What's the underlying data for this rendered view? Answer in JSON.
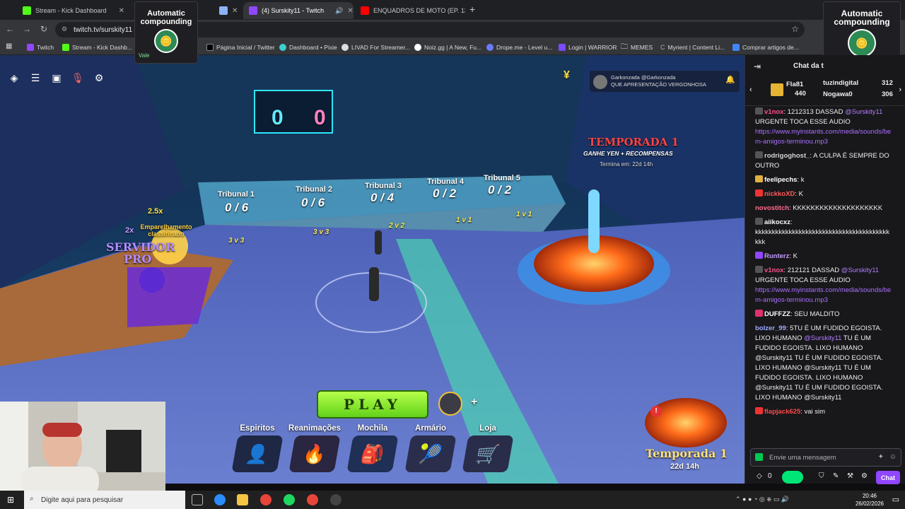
{
  "tabs": [
    {
      "label": "Stream - Kick Dashboard"
    },
    {
      "label": ""
    },
    {
      "label": "(4) Surskity11 - Twitch"
    },
    {
      "label": "ENQUADROS DE MOTO (EP. 13"
    }
  ],
  "address": {
    "url": "twitch.tv/surskity11"
  },
  "bookmarks": [
    "Twitch",
    "Stream - Kick Dashb...",
    "Página Inicial / Twitter",
    "Dashboard • Pixie",
    "LIVAD For Streamer...",
    "Noiz.gg | A New, Fu...",
    "Drope.me - Level u...",
    "Login | WARRIOR",
    "MEMES",
    "Myrient | Content Li...",
    "Comprar artigos de..."
  ],
  "ad": {
    "title": "Automatic compounding",
    "badge": "Vale"
  },
  "game": {
    "score_left": "0",
    "score_right": "0",
    "notification": {
      "name": "Garkonzada @Garkonzada",
      "text": "QUE APRESENTAÇÃO VERGONHOSA"
    },
    "season": {
      "title": "TEMPORADA 1",
      "subtitle": "GANHE YEN + RECOMPENSAS",
      "ends": "Termina em: 22d 14h"
    },
    "tribunals": [
      {
        "name": "Tribunal 1",
        "count": "0 / 6"
      },
      {
        "name": "Tribunal 2",
        "count": "0 / 6"
      },
      {
        "name": "Tribunal 3",
        "count": "0 / 4"
      },
      {
        "name": "Tribunal 4",
        "count": "0 / 2"
      },
      {
        "name": "Tribunal 5",
        "count": "0 / 2"
      }
    ],
    "pads": [
      "3 v 3",
      "3 v 3",
      "2 v 2",
      "1 v 1",
      "1 v 1"
    ],
    "multiplier_a": "2.5x",
    "multiplier_b": "2x",
    "ranked_text": "Emparelhamento classificado",
    "server_line1": "SERVIDOR",
    "server_line2": "PRO",
    "play_label": "PLAY",
    "menu": [
      {
        "label": "Espiritos",
        "icon": "spirit-icon"
      },
      {
        "label": "Reanimações",
        "icon": "flame-icon"
      },
      {
        "label": "Mochila",
        "icon": "bag-icon"
      },
      {
        "label": "Armário",
        "icon": "racket-icon"
      },
      {
        "label": "Loja",
        "icon": "cart-icon"
      }
    ],
    "season_badge": {
      "title": "Temporada 1",
      "time": "22d 14h"
    }
  },
  "chat": {
    "header": "Chat da t",
    "leaderboard": [
      {
        "name": "Fla81",
        "score": "440"
      },
      {
        "name": "tuzindigital",
        "score": "312"
      },
      {
        "name": "Nogawa0",
        "score": "306"
      }
    ],
    "messages": [
      {
        "user": "v1nox",
        "color": "#ff4f8b",
        "text": ": 1212313 DASSAD ",
        "mention": "@Surskity11",
        "rest": " URGENTE TOCA ESSE AUDIO ",
        "link": "https://www.myinstants.com/media/sounds/bem-amigos-terminou.mp3"
      },
      {
        "user": "rodrigoghost_",
        "color": "#d2d2d2",
        "text": ": A CULPA É SEMPRE DO OUTRO",
        "mention": "",
        "rest": "",
        "link": ""
      },
      {
        "user": "feelipechs",
        "color": "#ffffff",
        "text": ": k",
        "mention": "",
        "rest": "",
        "link": ""
      },
      {
        "user": "nickkoXD",
        "color": "#ff5a5a",
        "text": ": K",
        "mention": "",
        "rest": "",
        "link": ""
      },
      {
        "user": "novostitch",
        "color": "#ff6a8e",
        "text": ": KKKKKKKKKKKKKKKKKKKK",
        "mention": "",
        "rest": "",
        "link": ""
      },
      {
        "user": "aiikocxz",
        "color": "#ffffff",
        "text": ": kkkkkkkkkkkkkkkkkkkkkkkkkkkkkkkkkkkkkkkk kkk",
        "mention": "",
        "rest": "",
        "link": ""
      },
      {
        "user": "Runterz",
        "color": "#c69cff",
        "text": ": K",
        "mention": "",
        "rest": "",
        "link": ""
      },
      {
        "user": "v1nox",
        "color": "#ff4f8b",
        "text": ": 212121 DASSAD ",
        "mention": "@Surskity11",
        "rest": " URGENTE TOCA ESSE AUDIO ",
        "link": "https://www.myinstants.com/media/sounds/bem-amigos-terminou.mp3"
      },
      {
        "user": "DUFFZZ",
        "color": "#ffffff",
        "text": ": SEU MALDITO",
        "mention": "",
        "rest": "",
        "link": ""
      },
      {
        "user": "bolzer_99",
        "color": "#9ea8ff",
        "text": ": 5TU É UM FUDIDO EGOISTA. LIXO HUMANO ",
        "mention": "@Surskity11",
        "rest": " TU É UM FUDIDO EGOISTA. LIXO HUMANO @Surskity11 TU É UM FUDIDO EGOISTA. LIXO HUMANO @Surskity11 TU É UM FUDIDO EGOISTA. LIXO HUMANO @Surskity11 TU É UM FUDIDO EGOISTA. LIXO HUMANO @Surskity11",
        "link": ""
      },
      {
        "user": "flapjack625",
        "color": "#ff4a4a",
        "text": ": vai sim",
        "mention": "",
        "rest": "",
        "link": ""
      }
    ],
    "input_placeholder": "Envie uma mensagem",
    "points": "0",
    "chat_button": "Chat"
  },
  "taskbar": {
    "search": "Digite aqui para pesquisar",
    "time": "20:46",
    "date": "26/02/2026"
  }
}
